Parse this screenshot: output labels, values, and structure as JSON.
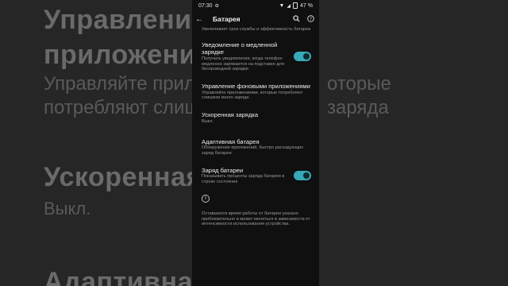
{
  "background": {
    "line1": "Управление",
    "line2": "приложения",
    "line3": "Управляйте прил",
    "line3b": "оторые",
    "line4": "потребляют слиш",
    "line4b": "заряда",
    "line5": "Ускоренная",
    "line6": "Выкл.",
    "line7": "Адаптивная"
  },
  "status_bar": {
    "time": "07:30",
    "battery_pct": "47 %"
  },
  "top_bar": {
    "title": "Батарея"
  },
  "top_desc": "Увеличивает срок службы и эффективность батареи",
  "settings": [
    {
      "title": "Уведомление о медленной зарядке",
      "desc": "Получать уведомления, когда телефон медленно заряжается на подставке для беспроводной зарядки",
      "toggle": true
    },
    {
      "title": "Управление фоновыми приложениями",
      "desc": "Управляйте приложениями, которые потребляют слишком много заряда",
      "toggle": null
    },
    {
      "title": "Ускоренная зарядка",
      "desc": "Выкл.",
      "toggle": null
    },
    {
      "title": "Адаптивная батарея",
      "desc": "Обнаружение приложений, быстро расходующих заряд батареи",
      "toggle": null
    },
    {
      "title": "Заряд батареи",
      "desc": "Показывать проценты заряда батареи в строке состояния",
      "toggle": true
    }
  ],
  "footer": "Оставшееся время работы от батареи указано приблизительно и может меняться в зависимости от интенсивности использования устройства.",
  "colors": {
    "accent": "#37a9b8",
    "bg": "#101010"
  }
}
